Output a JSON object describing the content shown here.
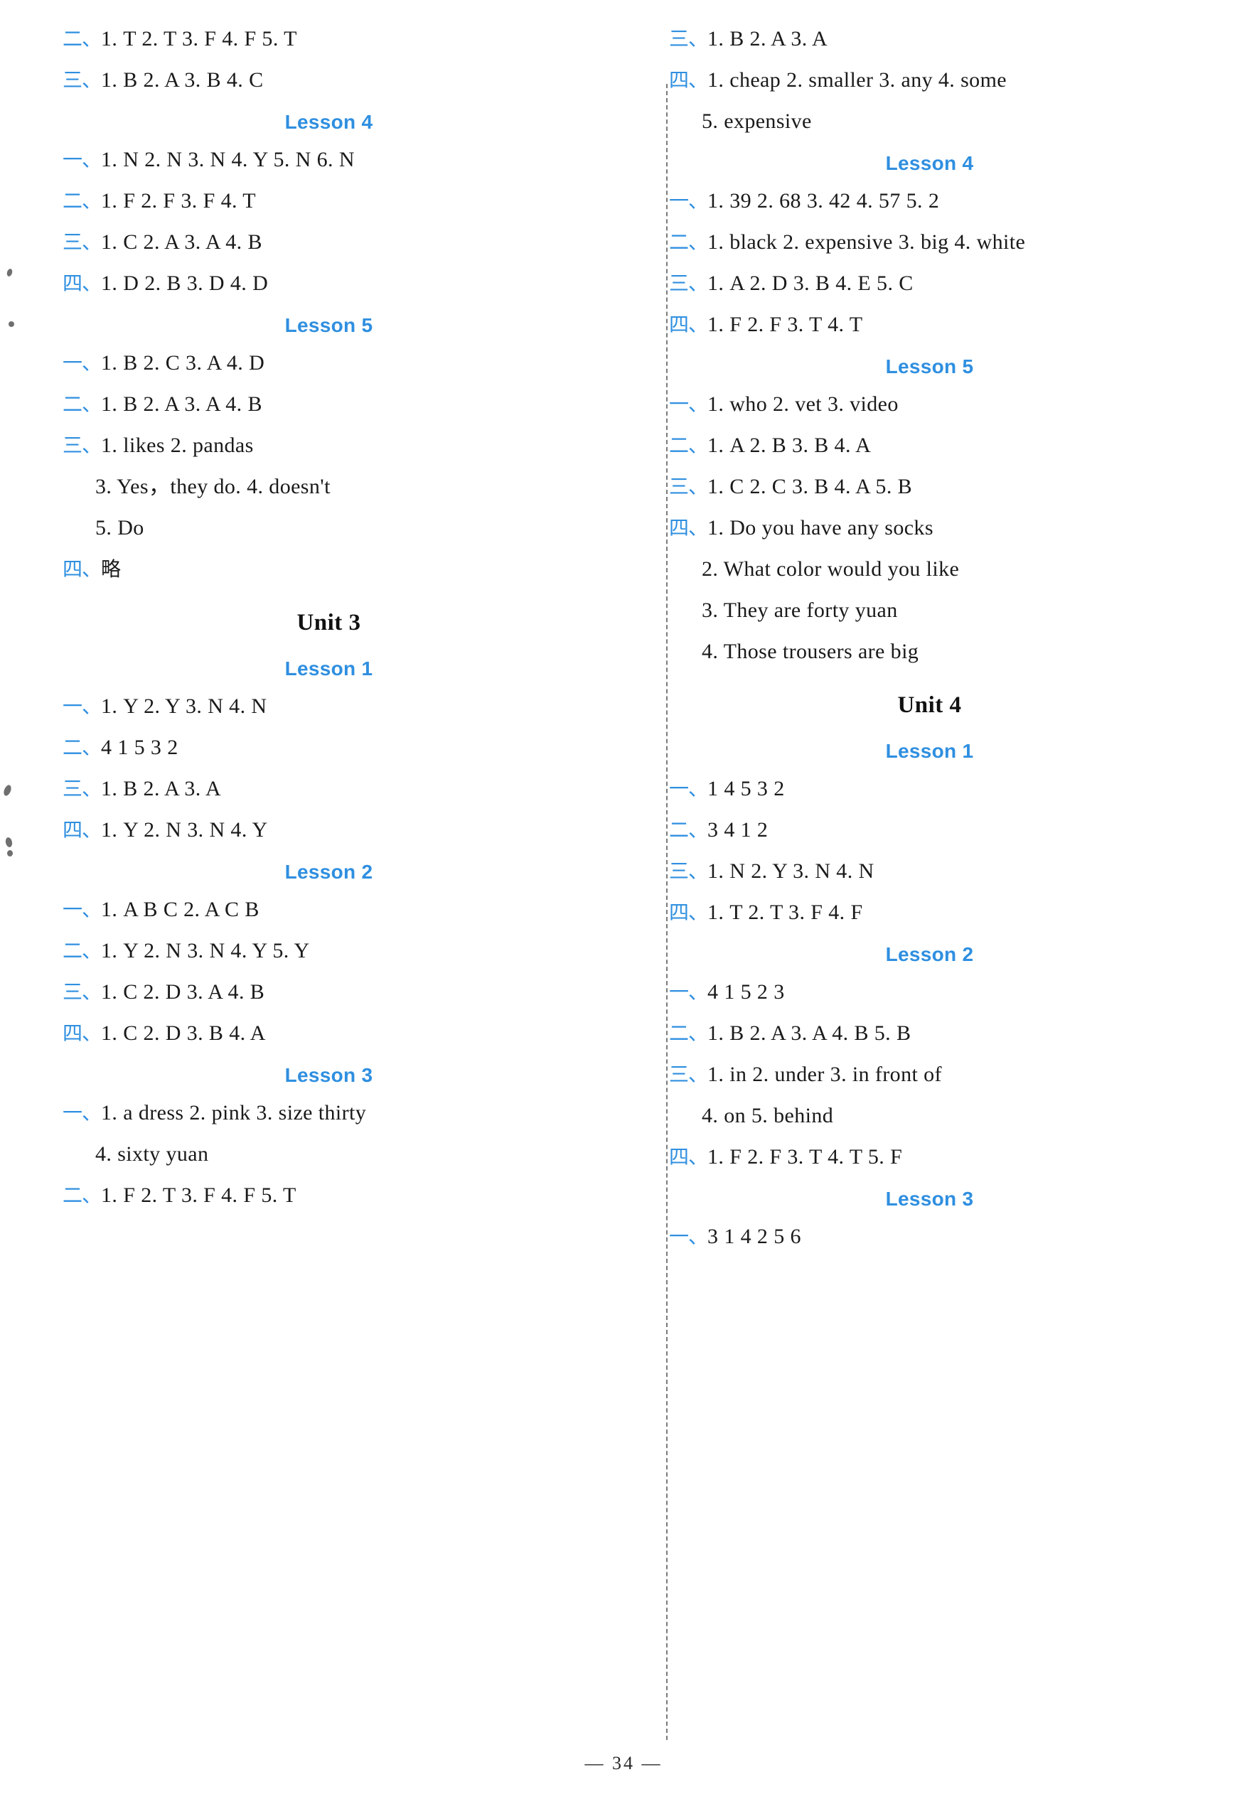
{
  "page": {
    "number": "— 34 —",
    "accent_color": "#2f8fe0",
    "text_color": "#1a1a1a"
  },
  "left_column": [
    {
      "kind": "answer",
      "marker": "二",
      "text": "1. T   2. T   3. F   4. F   5. T"
    },
    {
      "kind": "answer",
      "marker": "三",
      "text": "1. B   2. A   3. B   4. C"
    },
    {
      "kind": "lesson",
      "title": "Lesson 4"
    },
    {
      "kind": "answer",
      "marker": "一",
      "text": "1. N   2. N   3. N   4. Y   5. N   6. N"
    },
    {
      "kind": "answer",
      "marker": "二",
      "text": "1. F   2. F   3. F   4. T"
    },
    {
      "kind": "answer",
      "marker": "三",
      "text": "1. C   2. A   3. A   4. B"
    },
    {
      "kind": "answer",
      "marker": "四",
      "text": "1. D   2. B   3. D   4. D"
    },
    {
      "kind": "lesson",
      "title": "Lesson 5"
    },
    {
      "kind": "answer",
      "marker": "一",
      "text": "1. B   2. C   3. A   4. D"
    },
    {
      "kind": "answer",
      "marker": "二",
      "text": "1. B   2. A   3. A   4. B"
    },
    {
      "kind": "answer",
      "marker": "三",
      "text": "1. likes             2. pandas"
    },
    {
      "kind": "cont",
      "text": "3. Yes，they do.   4. doesn't"
    },
    {
      "kind": "cont",
      "text": "5. Do"
    },
    {
      "kind": "answer",
      "marker": "四",
      "text": "略",
      "cn_body": true
    },
    {
      "kind": "unit",
      "title": "Unit 3"
    },
    {
      "kind": "lesson",
      "title": "Lesson 1"
    },
    {
      "kind": "answer",
      "marker": "一",
      "text": "1. Y   2. Y   3. N   4. N"
    },
    {
      "kind": "answer",
      "marker": "二",
      "text": "4   1   5   3   2"
    },
    {
      "kind": "answer",
      "marker": "三",
      "text": "1. B   2. A   3. A"
    },
    {
      "kind": "answer",
      "marker": "四",
      "text": "1. Y   2. N   3. N   4. Y"
    },
    {
      "kind": "lesson",
      "title": "Lesson 2"
    },
    {
      "kind": "answer",
      "marker": "一",
      "text": "1. A   B   C   2. A   C   B"
    },
    {
      "kind": "answer",
      "marker": "二",
      "text": "1. Y   2. N   3. N   4. Y   5. Y"
    },
    {
      "kind": "answer",
      "marker": "三",
      "text": "1. C   2. D   3. A   4. B"
    },
    {
      "kind": "answer",
      "marker": "四",
      "text": "1. C   2. D   3. B   4. A"
    },
    {
      "kind": "lesson",
      "title": "Lesson 3"
    },
    {
      "kind": "answer",
      "marker": "一",
      "text": "1. a dress   2. pink   3. size thirty"
    },
    {
      "kind": "cont",
      "text": "4. sixty yuan"
    },
    {
      "kind": "answer",
      "marker": "二",
      "text": "1. F   2. T   3. F   4. F   5. T"
    }
  ],
  "right_column": [
    {
      "kind": "answer",
      "marker": "三",
      "text": "1. B   2. A   3. A"
    },
    {
      "kind": "answer",
      "marker": "四",
      "text": "1. cheap   2. smaller   3. any   4. some"
    },
    {
      "kind": "cont",
      "text": "5. expensive"
    },
    {
      "kind": "lesson",
      "title": "Lesson 4"
    },
    {
      "kind": "answer",
      "marker": "一",
      "text": "1. 39   2. 68   3. 42   4. 57   5. 2"
    },
    {
      "kind": "answer",
      "marker": "二",
      "text": "1. black   2. expensive   3. big   4. white"
    },
    {
      "kind": "answer",
      "marker": "三",
      "text": "1. A   2. D   3. B   4. E   5. C"
    },
    {
      "kind": "answer",
      "marker": "四",
      "text": "1. F   2. F   3. T   4. T"
    },
    {
      "kind": "lesson",
      "title": "Lesson 5"
    },
    {
      "kind": "answer",
      "marker": "一",
      "text": "1. who   2. vet   3. video"
    },
    {
      "kind": "answer",
      "marker": "二",
      "text": "1. A   2. B   3. B   4. A"
    },
    {
      "kind": "answer",
      "marker": "三",
      "text": "1. C   2. C   3. B   4. A   5. B"
    },
    {
      "kind": "answer",
      "marker": "四",
      "text": "1. Do you have any socks"
    },
    {
      "kind": "cont",
      "text": "2. What color would you like"
    },
    {
      "kind": "cont",
      "text": "3. They are forty yuan"
    },
    {
      "kind": "cont",
      "text": "4. Those trousers are big"
    },
    {
      "kind": "unit",
      "title": "Unit 4"
    },
    {
      "kind": "lesson",
      "title": "Lesson 1"
    },
    {
      "kind": "answer",
      "marker": "一",
      "text": "1   4   5   3   2"
    },
    {
      "kind": "answer",
      "marker": "二",
      "text": "3   4   1   2"
    },
    {
      "kind": "answer",
      "marker": "三",
      "text": "1. N   2. Y   3. N   4. N"
    },
    {
      "kind": "answer",
      "marker": "四",
      "text": "1. T   2. T   3. F   4. F"
    },
    {
      "kind": "lesson",
      "title": "Lesson 2"
    },
    {
      "kind": "answer",
      "marker": "一",
      "text": "4   1   5   2   3"
    },
    {
      "kind": "answer",
      "marker": "二",
      "text": "1. B   2. A   3. A   4. B   5. B"
    },
    {
      "kind": "answer",
      "marker": "三",
      "text": "1. in   2. under   3. in front of"
    },
    {
      "kind": "cont",
      "text": "4. on   5. behind"
    },
    {
      "kind": "answer",
      "marker": "四",
      "text": "1. F   2. F   3. T   4. T   5. F"
    },
    {
      "kind": "lesson",
      "title": "Lesson 3"
    },
    {
      "kind": "answer",
      "marker": "一",
      "text": "3   1   4   2   5   6"
    }
  ]
}
